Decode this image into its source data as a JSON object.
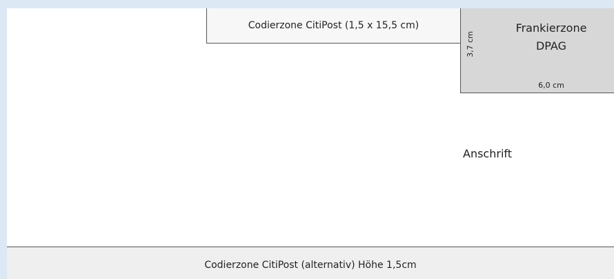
{
  "zones": {
    "coding_top": "Codierzone CitiPost (1,5 x 15,5 cm)",
    "franking_line1": "Frankierzone",
    "franking_line2": "DPAG",
    "franking_height": "3,7 cm",
    "franking_width": "6,0 cm",
    "address": "Anschrift",
    "coding_bottom": "Codierzone CitiPost (alternativ) Höhe 1,5cm"
  },
  "colors": {
    "page_background": "#dde8f5",
    "envelope": "#ffffff",
    "franking_fill": "#d7d7d7",
    "coding_bottom_fill": "#efefef",
    "border": "#555555"
  }
}
